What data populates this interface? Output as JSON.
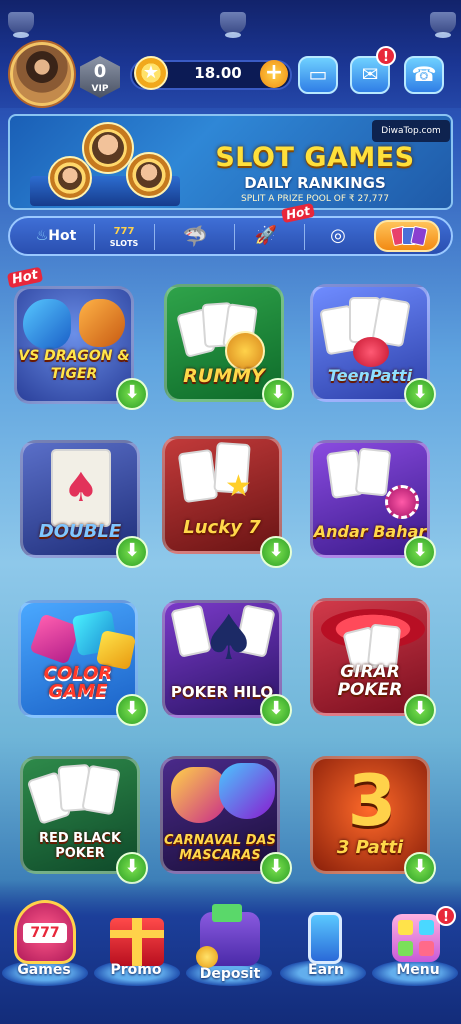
{
  "header": {
    "vip_level": "0",
    "vip_label": "VIP",
    "balance": "18.00",
    "add_symbol": "+",
    "notification_badge": "!",
    "icons": [
      "avatar",
      "vip-badge-icon",
      "coin-icon",
      "add-icon",
      "wallet-icon",
      "mail-icon",
      "support-icon"
    ]
  },
  "banner": {
    "brand": "DiwaTop.com",
    "title": "SLOT GAMES",
    "subtitle": "DAILY RANKINGS",
    "pool_text": "SPLIT A PRIZE POOL OF ₹ 27,777"
  },
  "tabs": [
    {
      "label": "Hot",
      "icon": "flame-icon"
    },
    {
      "label": "SLOTS",
      "icon": "slot-machine-icon"
    },
    {
      "label": "",
      "icon": "shark-icon"
    },
    {
      "label": "",
      "icon": "rocket-icon"
    },
    {
      "label": "",
      "icon": "roulette-icon"
    },
    {
      "label": "",
      "icon": "cards-icon",
      "active": true
    }
  ],
  "tabs_hot_tag": "Hot",
  "games": [
    {
      "label": "VS DRAGON & TIGER",
      "hot": true
    },
    {
      "label": "RUMMY"
    },
    {
      "label": "TeenPatti"
    },
    {
      "label": "DOUBLE"
    },
    {
      "label": "Lucky 7"
    },
    {
      "label": "Andar Bahar"
    },
    {
      "label": "COLOR GAME"
    },
    {
      "label": "POKER HILO"
    },
    {
      "label": "GIRAR POKER"
    },
    {
      "label": "RED BLACK POKER"
    },
    {
      "label": "CARNAVAL DAS MASCARAS"
    },
    {
      "label": "3 Patti"
    }
  ],
  "game_hot_tag": "Hot",
  "download_symbol": "⬇",
  "bottom_nav": [
    {
      "label": "Games"
    },
    {
      "label": "Promo"
    },
    {
      "label": "Deposit"
    },
    {
      "label": "Earn"
    },
    {
      "label": "Menu"
    }
  ],
  "colors": {
    "accent_gold": "#ffe03b",
    "download_green": "#2c9e25",
    "badge_red": "#e8283a",
    "nav_blue": "#1c3f9a"
  }
}
